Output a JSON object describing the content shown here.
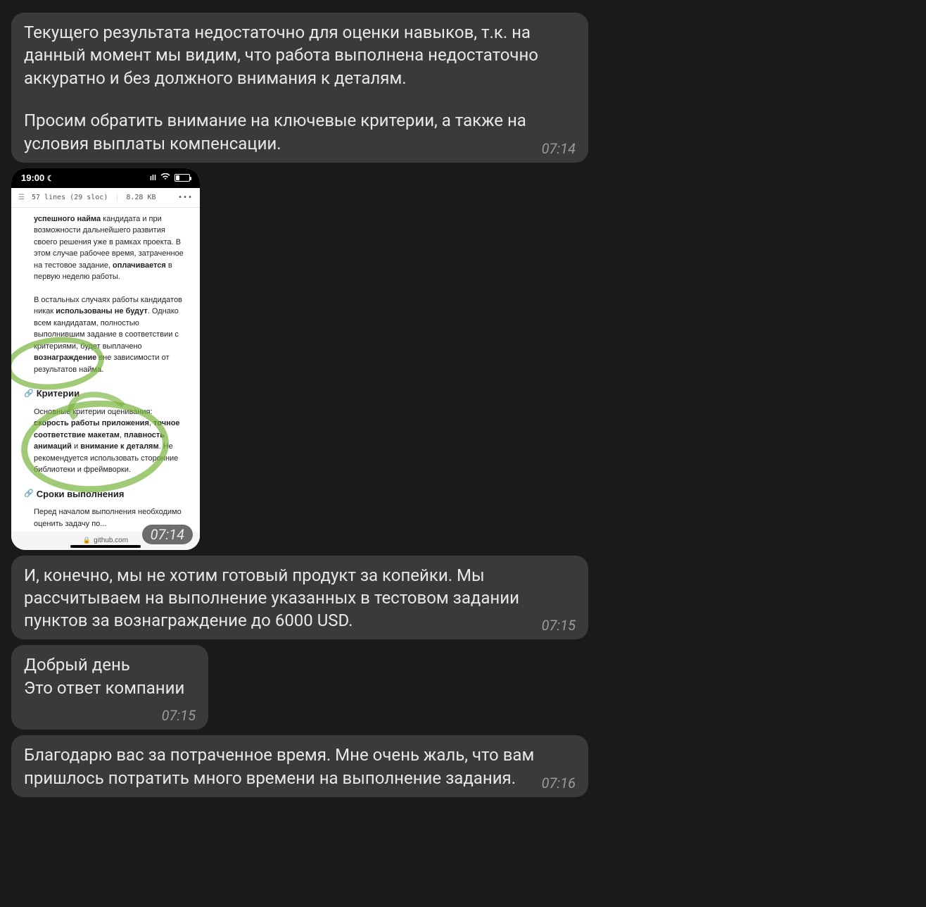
{
  "messages": {
    "m1": {
      "p1": "Текущего результата недостаточно для оценки навыков, т.к. на данный момент мы видим, что работа выполнена недостаточно аккуратно и без должного внимания к деталям.",
      "p2": "Просим обратить внимание на ключевые критерии, а также на условия выплаты компенсации.",
      "time": "07:14"
    },
    "attachment": {
      "time": "07:14",
      "status_time": "19:00",
      "gh_lines": "57 lines (29 sloc)",
      "gh_size": "8.28 KB",
      "doc": {
        "para1_a": "успешного найма",
        "para1_b": " кандидата и при возможности дальнейшего развития своего решения уже в рамках проекта. В этом случае рабочее время, затраченное на тестовое задание, ",
        "para1_c": "оплачивается",
        "para1_d": " в первую неделю работы.",
        "para2_a": "В остальных случаях работы кандидатов никак ",
        "para2_b": "использованы не будут",
        "para2_c": ". Однако всем кандидатам, полностью выполнившим задание в соответствии с критериями, будет выплачено ",
        "para2_d": "вознаграждение",
        "para2_e": " вне зависимости от результатов найма.",
        "h_criteria": "Критерии",
        "para3_a": "Основные критерии оценивания: ",
        "para3_b": "скорость работы приложения",
        "para3_c": ", ",
        "para3_d": "точное соответствие макетам",
        "para3_e": ", ",
        "para3_f": "плавность анимаций",
        "para3_g": " и ",
        "para3_h": "внимание к деталям",
        "para3_i": ". Не рекомендуется использовать сторонние библиотеки и фреймворки.",
        "h_deadline": "Сроки выполнения",
        "para4": "Перед началом выполнения необходимо оценить задачу по...",
        "url": "github.com"
      }
    },
    "m3": {
      "text": "И, конечно, мы не хотим готовый продукт за копейки. Мы рассчитываем на выполнение указанных в тестовом задании пунктов за вознаграждение до 6000 USD.",
      "time": "07:15"
    },
    "m4": {
      "l1": "Добрый день",
      "l2": "Это ответ компании",
      "time": "07:15"
    },
    "m5": {
      "text": "Благодарю вас за потраченное время. Мне очень жаль, что вам пришлось потратить много времени на выполнение задания.",
      "time": "07:16"
    }
  }
}
